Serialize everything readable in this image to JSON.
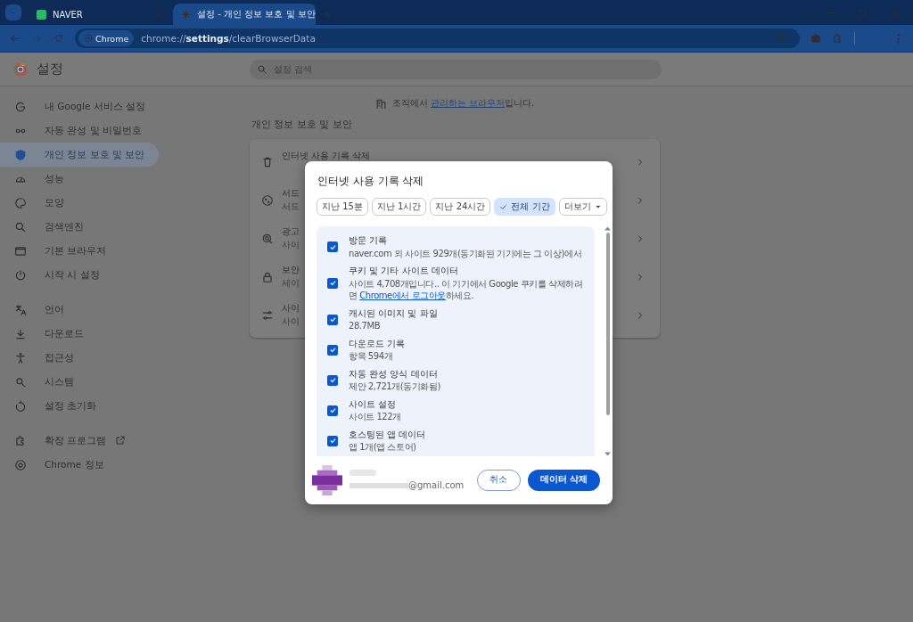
{
  "browser": {
    "tabs": [
      {
        "title": "NAVER",
        "selected": false
      },
      {
        "title": "설정 - 개인 정보 보호 및 보안",
        "selected": true
      }
    ],
    "address": {
      "chip": "Chrome",
      "url": "chrome://**settings**/clearBrowserData"
    }
  },
  "settings": {
    "title": "설정",
    "search": {
      "placeholder": "설정 검색"
    },
    "sidebar": [
      [
        {
          "label": "내 Google 서비스 설정",
          "selected": false
        },
        {
          "label": "자동 완성 및 비밀번호",
          "selected": false
        },
        {
          "label": "개인 정보 보호 및 보안",
          "selected": true
        },
        {
          "label": "성능",
          "selected": false
        },
        {
          "label": "모양",
          "selected": false
        },
        {
          "label": "검색엔진",
          "selected": false
        },
        {
          "label": "기본 브라우저",
          "selected": false
        },
        {
          "label": "시작 시 설정",
          "selected": false
        }
      ],
      [
        {
          "label": "언어",
          "selected": false
        },
        {
          "label": "다운로드",
          "selected": false
        },
        {
          "label": "접근성",
          "selected": false
        },
        {
          "label": "시스템",
          "selected": false
        },
        {
          "label": "설정 초기화",
          "selected": false
        }
      ],
      [
        {
          "label": "확장 프로그램",
          "selected": false
        },
        {
          "label": "Chrome 정보",
          "selected": false
        }
      ]
    ],
    "notice": {
      "before": "조직에서 ",
      "link": "관리하는 브라우저",
      "after": "입니다."
    },
    "section_title": "개인 정보 보호 및 보안",
    "rows": [
      {
        "title": "인터넷 사용 기록 삭제"
      },
      {
        "title": "서드",
        "subtitle": "서드"
      },
      {
        "title": "광고",
        "subtitle": "사이"
      },
      {
        "title": "보안",
        "subtitle": "세이"
      },
      {
        "title": "사이",
        "subtitle": "사이"
      }
    ]
  },
  "dialog": {
    "title": "인터넷 사용 기록 삭제",
    "ranges": [
      {
        "label": "지난 15분",
        "selected": false
      },
      {
        "label": "지난 1시간",
        "selected": false
      },
      {
        "label": "지난 24시간",
        "selected": false
      },
      {
        "label": "전체 기간",
        "selected": true
      }
    ],
    "more": "더보기",
    "items": [
      {
        "title": "방문 기록",
        "detail": "naver.com 외 사이트 929개(동기화된 기기에는 그 이상)에서",
        "checked": true
      },
      {
        "title": "쿠키 및 기타 사이트 데이터",
        "detail": "사이트 4,708개입니다.. 이 기기에서 Google 쿠키를 삭제하려면 ",
        "link": "Chrome에서 로그아웃",
        "detail_after": "하세요.",
        "checked": true
      },
      {
        "title": "캐시된 이미지 및 파일",
        "detail": "28.7MB",
        "checked": true
      },
      {
        "title": "다운로드 기록",
        "detail": "항목 594개",
        "checked": true
      },
      {
        "title": "자동 완성 양식 데이터",
        "detail": "제안 2,721개(동기화됨)",
        "checked": true
      },
      {
        "title": "사이트 설정",
        "detail": "사이트 122개",
        "checked": true
      },
      {
        "title": "호스팅된 앱 데이터",
        "detail": "앱 1개(앱 스토어)",
        "checked": true
      }
    ],
    "account": {
      "email": "@gmail.com"
    },
    "cancel": "취소",
    "confirm": "데이터 삭제"
  }
}
